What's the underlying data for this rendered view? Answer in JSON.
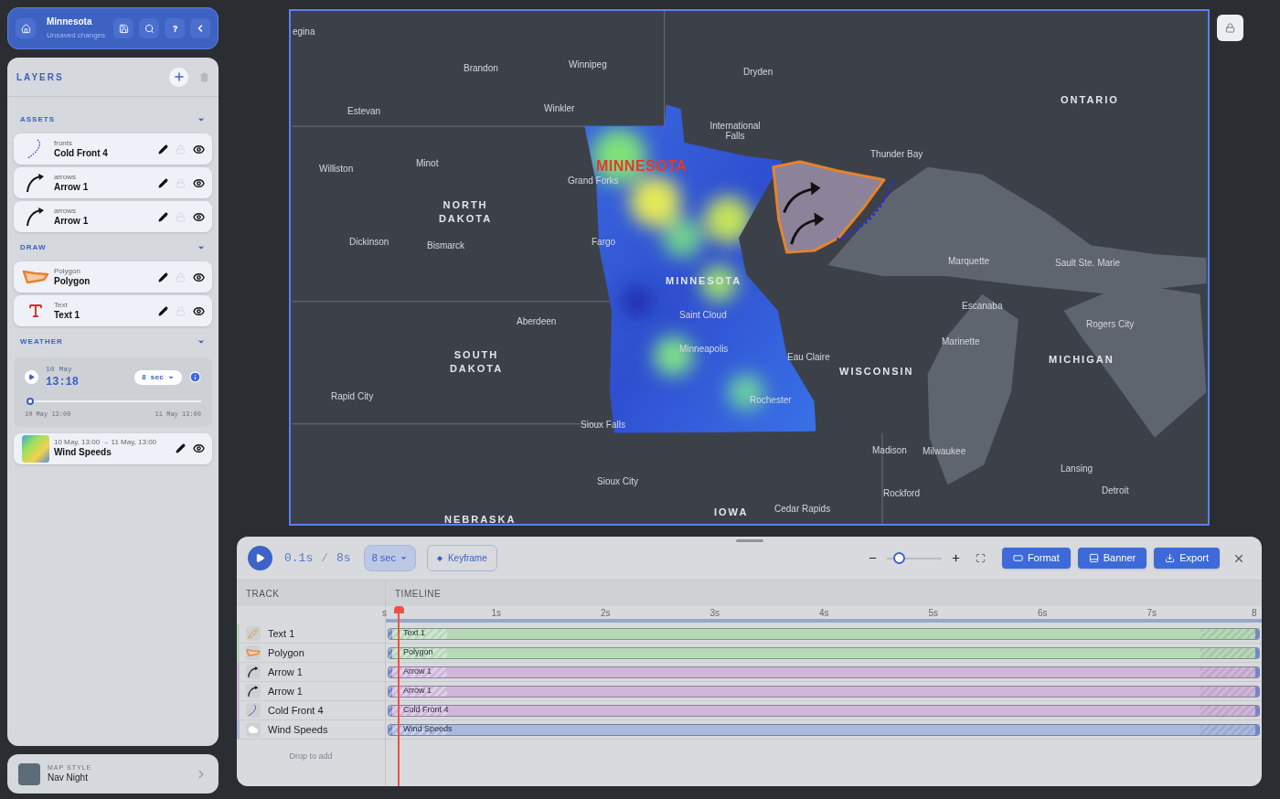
{
  "project": {
    "title": "Minnesota",
    "status": "Unsaved changes"
  },
  "layers": {
    "title": "LAYERS",
    "sections": [
      {
        "title": "ASSETS",
        "expanded": true,
        "items": [
          {
            "kind": "front",
            "category": "fronts",
            "name": "Cold Front 4",
            "locked": false,
            "visible": true
          },
          {
            "kind": "arrow",
            "category": "arrows",
            "name": "Arrow 1",
            "locked": false,
            "visible": true
          },
          {
            "kind": "arrow",
            "category": "arrows",
            "name": "Arrow 1",
            "locked": false,
            "visible": true
          }
        ]
      },
      {
        "title": "DRAW",
        "expanded": true,
        "items": [
          {
            "kind": "polygon",
            "category": "Polygon",
            "name": "Polygon",
            "locked": false,
            "visible": true
          },
          {
            "kind": "text",
            "category": "Text",
            "name": "Text 1",
            "locked": false,
            "visible": true
          }
        ]
      },
      {
        "title": "WEATHER",
        "expanded": true,
        "player": {
          "playing": false,
          "date": "10 May",
          "time": "13:18",
          "duration": "8 sec",
          "level": 0.0125,
          "start": "10 May 13:00",
          "end": "11 May 13:00"
        },
        "items": [
          {
            "kind": "weather",
            "category": "10 May, 13:00 → 11 May, 13:00",
            "name": "Wind Speeds",
            "visible": true
          }
        ]
      }
    ]
  },
  "map_style": {
    "label": "MAP STYLE",
    "name": "Nav Night"
  },
  "map": {
    "overlay_text": "MINNESOTA",
    "labels": [
      {
        "text": "egina",
        "kind": "city"
      },
      {
        "text": "Brandon",
        "kind": "city"
      },
      {
        "text": "Winnipeg",
        "kind": "city"
      },
      {
        "text": "Dryden",
        "kind": "city"
      },
      {
        "text": "ONTARIO",
        "kind": "region"
      },
      {
        "text": "Estevan",
        "kind": "city"
      },
      {
        "text": "Winkler",
        "kind": "city"
      },
      {
        "text": "International Falls",
        "kind": "city"
      },
      {
        "text": "Williston",
        "kind": "city"
      },
      {
        "text": "Minot",
        "kind": "city"
      },
      {
        "text": "Thunder Bay",
        "kind": "city"
      },
      {
        "text": "Grand Forks",
        "kind": "city"
      },
      {
        "text": "NORTH DAKOTA",
        "kind": "region"
      },
      {
        "text": "Dickinson",
        "kind": "city"
      },
      {
        "text": "Bismarck",
        "kind": "city"
      },
      {
        "text": "Fargo",
        "kind": "city"
      },
      {
        "text": "Marquette",
        "kind": "city"
      },
      {
        "text": "Sault Ste. Marie",
        "kind": "city"
      },
      {
        "text": "MINNESOTA",
        "kind": "region"
      },
      {
        "text": "Aberdeen",
        "kind": "city"
      },
      {
        "text": "Saint Cloud",
        "kind": "city"
      },
      {
        "text": "Escanaba",
        "kind": "city"
      },
      {
        "text": "Rogers City",
        "kind": "city"
      },
      {
        "text": "SOUTH DAKOTA",
        "kind": "region"
      },
      {
        "text": "Minneapolis",
        "kind": "city"
      },
      {
        "text": "Eau Claire",
        "kind": "city"
      },
      {
        "text": "WISCONSIN",
        "kind": "region"
      },
      {
        "text": "Marinette",
        "kind": "city"
      },
      {
        "text": "MICHIGAN",
        "kind": "region"
      },
      {
        "text": "Rapid City",
        "kind": "city"
      },
      {
        "text": "Rochester",
        "kind": "city"
      },
      {
        "text": "Sioux Falls",
        "kind": "city"
      },
      {
        "text": "Madison",
        "kind": "city"
      },
      {
        "text": "Milwaukee",
        "kind": "city"
      },
      {
        "text": "Lansing",
        "kind": "city"
      },
      {
        "text": "Sioux City",
        "kind": "city"
      },
      {
        "text": "Rockford",
        "kind": "city"
      },
      {
        "text": "Detroit",
        "kind": "city"
      },
      {
        "text": "NEBRASKA",
        "kind": "region"
      },
      {
        "text": "IOWA",
        "kind": "region"
      },
      {
        "text": "Cedar Rapids",
        "kind": "city"
      }
    ]
  },
  "timeline": {
    "playing": false,
    "current": "0.1s",
    "separator": "/",
    "total": "8s",
    "duration": "8 sec",
    "keyframe": "Keyframe",
    "zoom": {
      "level": 0.15
    },
    "buttons": [
      {
        "kind": "format",
        "label": "Format"
      },
      {
        "kind": "banner",
        "label": "Banner"
      },
      {
        "kind": "export",
        "label": "Export"
      }
    ],
    "columns": [
      "TRACK",
      "TIMELINE"
    ],
    "ticks": [
      "s",
      "1s",
      "2s",
      "3s",
      "4s",
      "5s",
      "6s",
      "7s",
      "8"
    ],
    "playhead": {
      "level": 0.0125
    },
    "tracks": [
      {
        "kind": "text",
        "name": "Text 1",
        "clip_label": "Text 1",
        "color": "#b7d9b8"
      },
      {
        "kind": "polygon",
        "name": "Polygon",
        "clip_label": "Polygon",
        "color": "#b7d9b8"
      },
      {
        "kind": "arrow",
        "name": "Arrow 1",
        "clip_label": "Arrow 1",
        "color": "#cfb6da"
      },
      {
        "kind": "arrow",
        "name": "Arrow 1",
        "clip_label": "Arrow 1",
        "color": "#cfb6da"
      },
      {
        "kind": "front",
        "name": "Cold Front 4",
        "clip_label": "Cold Front 4",
        "color": "#cfb6da"
      },
      {
        "kind": "weather",
        "name": "Wind Speeds",
        "clip_label": "Wind Speeds",
        "color": "#aab9de"
      }
    ],
    "drop_hint": "Drop to add"
  }
}
